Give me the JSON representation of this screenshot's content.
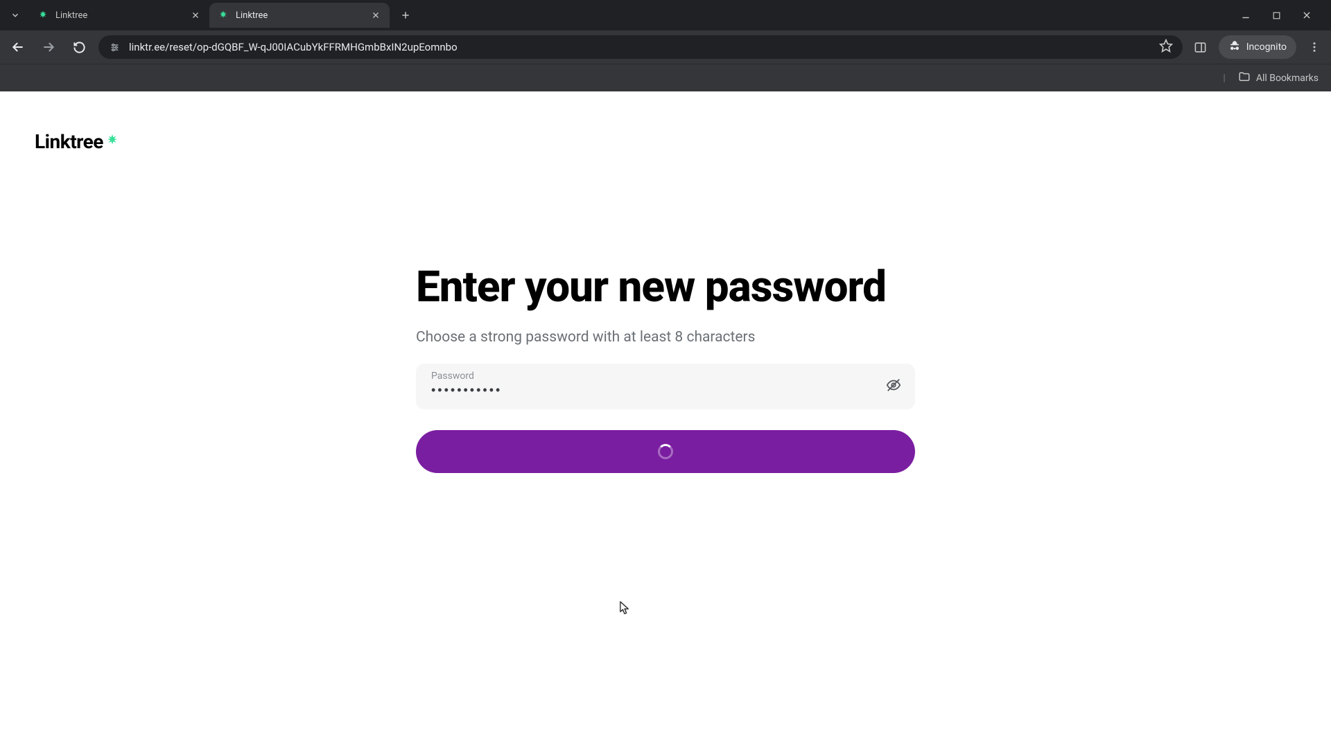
{
  "browser": {
    "tabs": [
      {
        "title": "Linktree",
        "active": false
      },
      {
        "title": "Linktree",
        "active": true
      }
    ],
    "url_display": "linktr.ee/reset/op-dGQBF_W-qJ00IACubYkFFRMHGmbBxIN2upEomnbo",
    "incognito_label": "Incognito",
    "all_bookmarks_label": "All Bookmarks"
  },
  "page": {
    "logo_text": "Linktree",
    "heading": "Enter your new password",
    "subtext": "Choose a strong password with at least 8 characters",
    "password_label": "Password",
    "password_value": "•••••••••••",
    "submit_loading": true
  },
  "colors": {
    "accent_purple": "#7a1ea1",
    "brand_green": "#39e09b"
  }
}
